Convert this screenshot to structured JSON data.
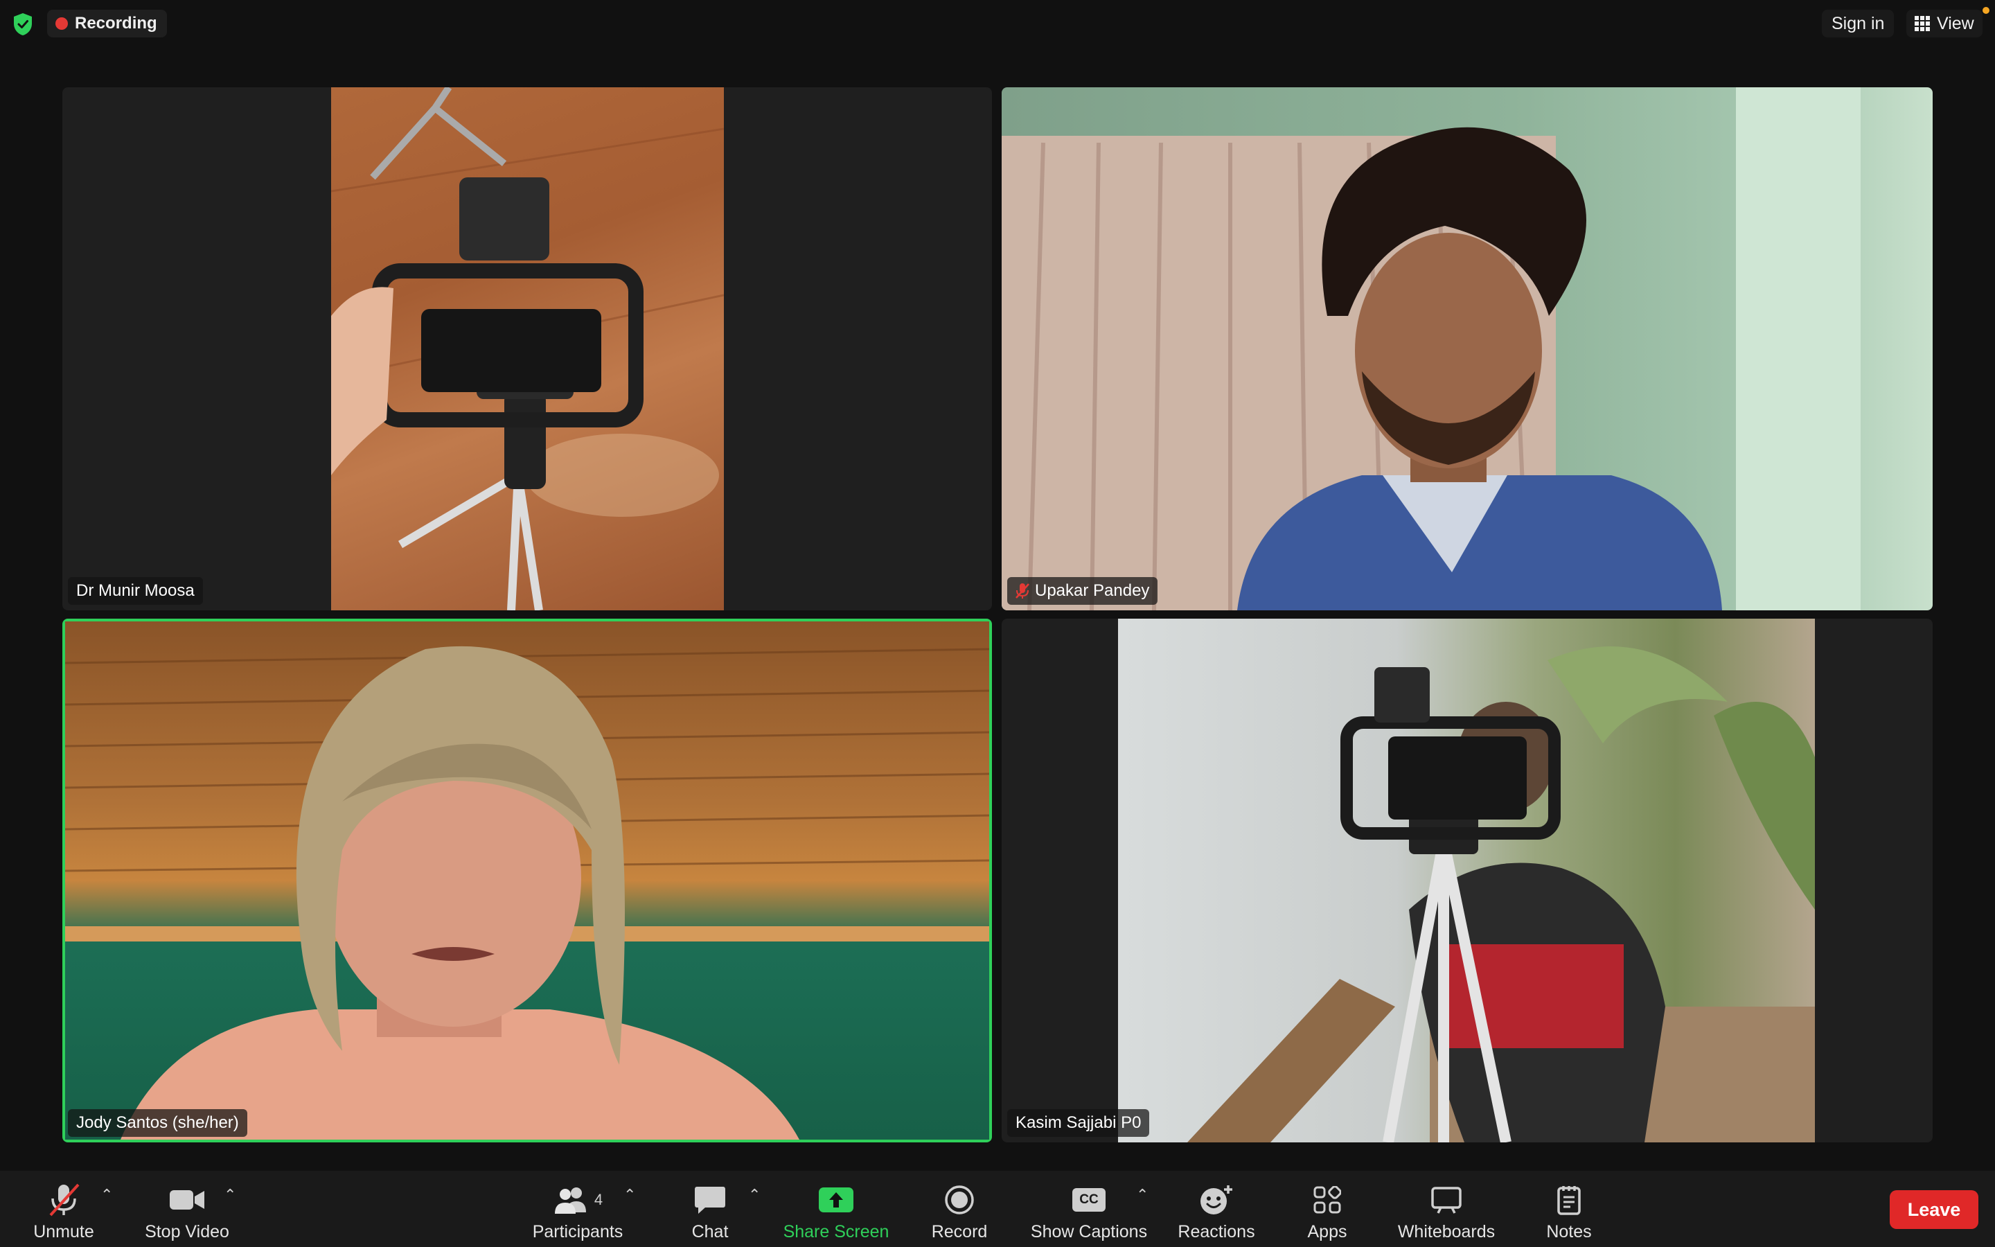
{
  "topbar": {
    "recording_label": "Recording",
    "sign_in_label": "Sign in",
    "view_label": "View"
  },
  "participants": [
    {
      "name": "Dr Munir Moosa",
      "muted": false,
      "active_speaker": false
    },
    {
      "name": "Upakar Pandey",
      "muted": true,
      "active_speaker": false
    },
    {
      "name": "Jody Santos (she/her)",
      "muted": false,
      "active_speaker": true
    },
    {
      "name": "Kasim Sajjabi P0",
      "muted": false,
      "active_speaker": false
    }
  ],
  "toolbar": {
    "unmute": "Unmute",
    "stop_video": "Stop Video",
    "participants": "Participants",
    "participants_count": "4",
    "chat": "Chat",
    "share_screen": "Share Screen",
    "record": "Record",
    "show_captions": "Show Captions",
    "captions_badge": "CC",
    "reactions": "Reactions",
    "apps": "Apps",
    "whiteboards": "Whiteboards",
    "notes": "Notes",
    "leave": "Leave"
  },
  "colors": {
    "accent_green": "#2fd05a",
    "leave_red": "#e02828",
    "recording_red": "#e53935",
    "background": "#111111"
  }
}
